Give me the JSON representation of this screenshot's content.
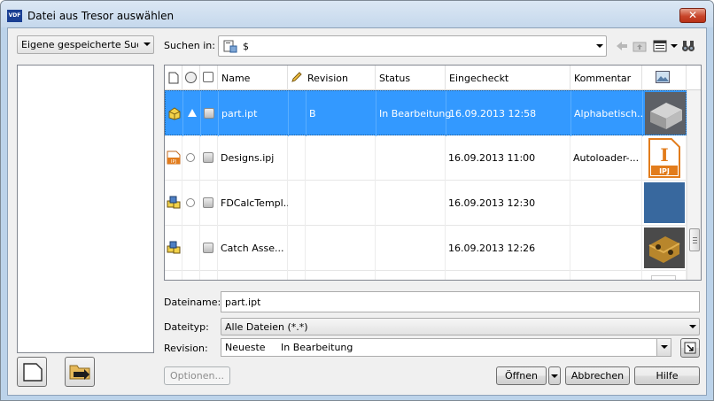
{
  "window": {
    "app_icon_text": "VDF",
    "title": "Datei aus Tresor auswählen",
    "close_glyph": "✕"
  },
  "saved_searches": {
    "value": "Eigene gespeicherte Suchvo"
  },
  "search_in": {
    "label": "Suchen in:",
    "value": "$"
  },
  "grid": {
    "headers": {
      "name": "Name",
      "revision": "Revision",
      "status": "Status",
      "checked_in": "Eingecheckt",
      "comment": "Kommentar"
    },
    "rows": [
      {
        "name": "part.ipt",
        "revision": "B",
        "status": "In Bearbeitung",
        "checked_in": "16.09.2013 12:58",
        "comment": "Alphabetisch...",
        "thumbnail": "gray-part-thumbnail"
      },
      {
        "name": "Designs.ipj",
        "revision": "",
        "status": "",
        "checked_in": "16.09.2013 11:00",
        "comment": "Autoloader-...",
        "thumbnail": "ipj-file-thumbnail",
        "thumb_letter": "I",
        "thumb_caption": "IPJ",
        "type_icon_text": "IPJ"
      },
      {
        "name": "FDCalcTempl...",
        "revision": "",
        "status": "",
        "checked_in": "16.09.2013 12:30",
        "comment": "",
        "thumbnail": "blue-thumbnail"
      },
      {
        "name": "Catch Asse...",
        "revision": "",
        "status": "",
        "checked_in": "16.09.2013 12:26",
        "comment": "",
        "thumbnail": "catch-assembly-thumbnail"
      }
    ]
  },
  "filename": {
    "label": "Dateiname:",
    "value": "part.ipt"
  },
  "filetype": {
    "label": "Dateityp:",
    "value": "Alle Dateien (*.*)"
  },
  "revision": {
    "label": "Revision:",
    "value": "Neueste     In Bearbeitung"
  },
  "buttons": {
    "options": "Optionen...",
    "open": "Öffnen",
    "cancel": "Abbrechen",
    "help": "Hilfe"
  },
  "colors": {
    "selection": "#3399ff",
    "title_bar": "#c5d8ec",
    "close": "#c8452b"
  }
}
